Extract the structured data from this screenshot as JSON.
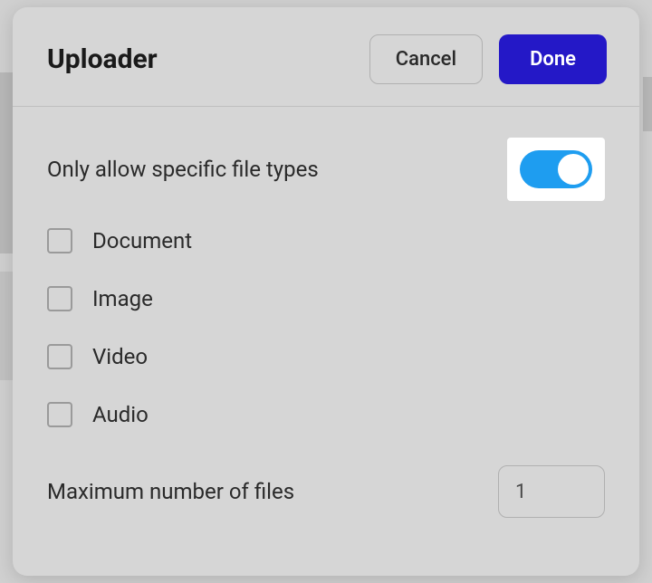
{
  "dialog": {
    "title": "Uploader",
    "cancel_label": "Cancel",
    "done_label": "Done"
  },
  "settings": {
    "allow_specific_label": "Only allow specific file types",
    "allow_specific_on": true,
    "file_types": [
      {
        "label": "Document",
        "checked": false
      },
      {
        "label": "Image",
        "checked": false
      },
      {
        "label": "Video",
        "checked": false
      },
      {
        "label": "Audio",
        "checked": false
      }
    ],
    "max_files_label": "Maximum number of files",
    "max_files_value": "1"
  }
}
